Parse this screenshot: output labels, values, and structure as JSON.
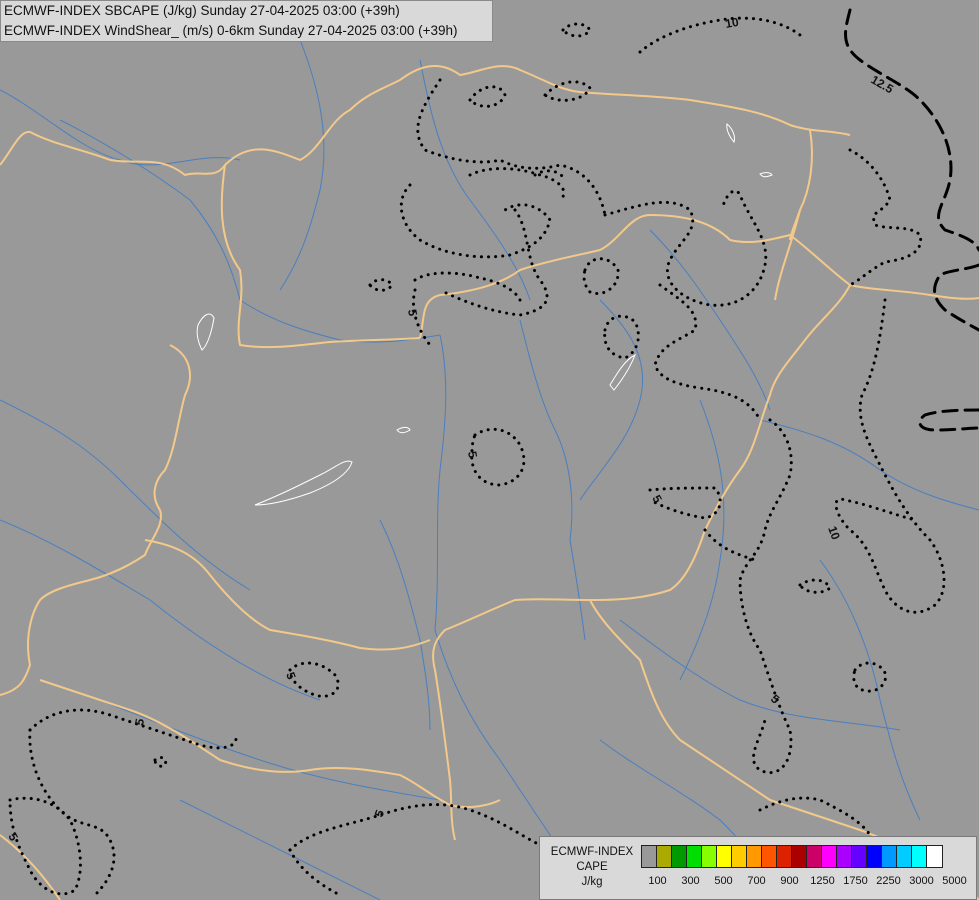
{
  "title": {
    "line1": "ECMWF-INDEX SBCAPE (J/kg) Sunday 27-04-2025 03:00 (+39h)",
    "line2": "ECMWF-INDEX WindShear_ (m/s) 0-6km Sunday 27-04-2025 03:00 (+39h)"
  },
  "map": {
    "background_color": "#999999",
    "border_color": "#f2c98a",
    "river_color": "#4a7fc0",
    "lake_outline_color": "#ffffff",
    "contour_color": "#000000",
    "contour_labels": [
      "10",
      "12.5",
      "5",
      "5",
      "5",
      "10",
      "5",
      "5",
      "5",
      "5",
      "5"
    ]
  },
  "legend": {
    "lines": [
      "ECMWF-INDEX",
      "CAPE",
      "J/kg"
    ],
    "colors": [
      "#999999",
      "#aaaa00",
      "#009900",
      "#00dd00",
      "#88ff00",
      "#ffff00",
      "#ffcc00",
      "#ff9900",
      "#ff5500",
      "#dd2200",
      "#aa0000",
      "#cc0066",
      "#ff00ff",
      "#aa00ff",
      "#6600ff",
      "#0000ff",
      "#0099ff",
      "#00ccff",
      "#00ffff",
      "#ffffff"
    ],
    "ticks": [
      "100",
      "300",
      "500",
      "700",
      "900",
      "1250",
      "1750",
      "2250",
      "3000",
      "5000"
    ]
  }
}
